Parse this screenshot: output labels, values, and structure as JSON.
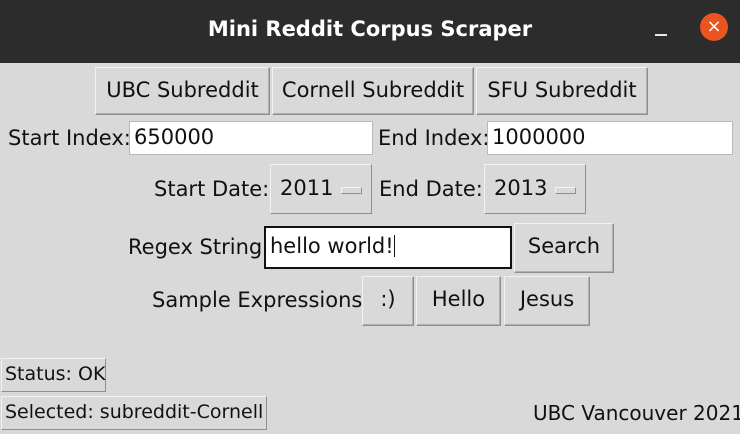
{
  "window": {
    "title": "Mini Reddit Corpus Scraper",
    "close_glyph": "×"
  },
  "subreddits": {
    "ubc": "UBC Subreddit",
    "cornell": "Cornell Subreddit",
    "sfu": "SFU Subreddit"
  },
  "indices": {
    "start_label": "Start Index:",
    "start_value": "650000",
    "end_label": "End Index:",
    "end_value": "1000000"
  },
  "dates": {
    "start_label": "Start Date:",
    "start_value": "2011",
    "end_label": "End Date:",
    "end_value": "2013"
  },
  "regex": {
    "label": "Regex String:",
    "value": "hello world!",
    "search_label": "Search"
  },
  "samples": {
    "label": "Sample Expressions:",
    "items": [
      ":)",
      "Hello",
      "Jesus"
    ]
  },
  "status": {
    "status_text": "Status: OK",
    "selected_text": "Selected: subreddit-Cornell",
    "footer": "UBC Vancouver 2021"
  }
}
